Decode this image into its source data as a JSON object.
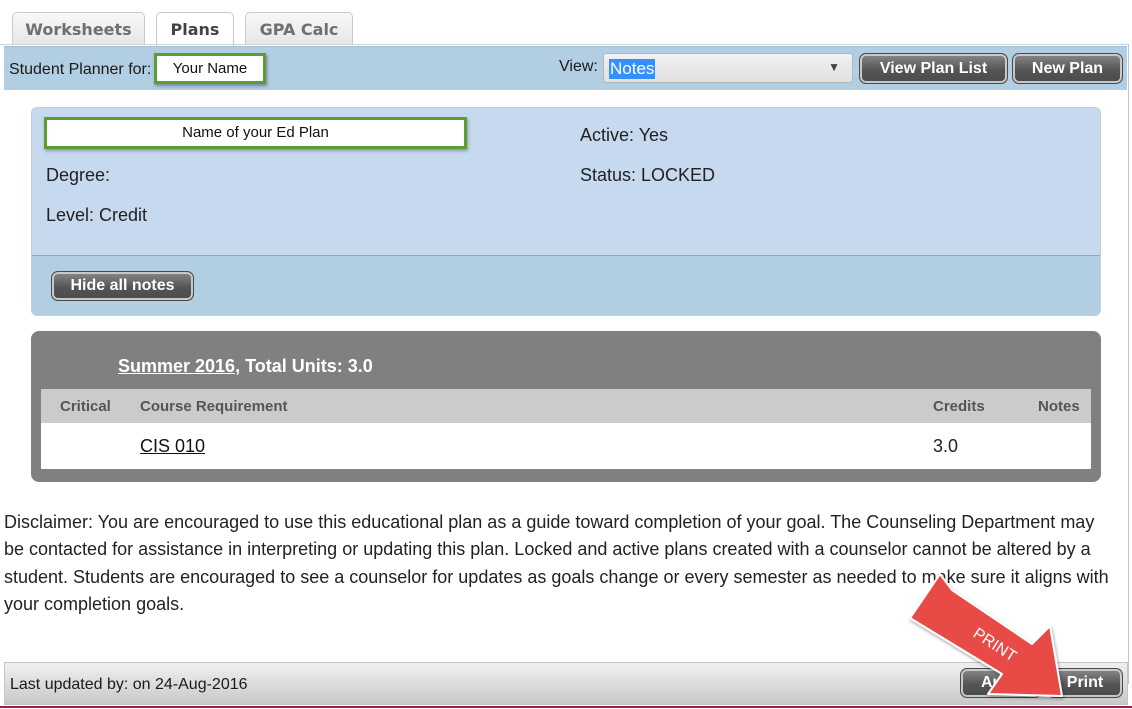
{
  "tabs": [
    {
      "label": "Worksheets",
      "active": false
    },
    {
      "label": "Plans",
      "active": true
    },
    {
      "label": "GPA Calc",
      "active": false
    }
  ],
  "header": {
    "planner_label": "Student Planner for:",
    "student_name": "Your Name",
    "view_label": "View:",
    "view_selected": "Notes",
    "view_plan_list_button": "View Plan List",
    "new_plan_button": "New Plan"
  },
  "plan": {
    "name": "Name of your Ed Plan",
    "degree": "Degree:",
    "level": "Level: Credit",
    "active": "Active: Yes",
    "status": "Status: LOCKED",
    "hide_notes_button": "Hide all notes"
  },
  "term": {
    "name": "Summer 2016",
    "total_units_text": ", Total Units: 3.0",
    "columns": [
      "Critical",
      "Course Requirement",
      "Credits",
      "Notes"
    ],
    "rows": [
      {
        "critical": "",
        "course": "CIS 010",
        "credits": "3.0",
        "notes": ""
      }
    ]
  },
  "disclaimer": "Disclaimer: You are encouraged to use this educational plan as a guide toward completion of your goal. The Counseling Department may be contacted for assistance in interpreting or updating this plan. Locked and active plans created with a counselor cannot be altered by a student. Students are encouraged to see a counselor for updates as goals change or every semester as needed to make sure it aligns with your completion goals.",
  "footer": {
    "last_updated": "Last updated by: on 24-Aug-2016",
    "audit_button": "Audit",
    "print_button": "Print"
  },
  "annotation": {
    "label": "PRINT",
    "color": "#e84c45"
  },
  "colors": {
    "header_bar": "#b1cee3",
    "plan_panel": "#c6d9ef",
    "highlight_border": "#5a9e2f",
    "term_block": "#808080"
  }
}
